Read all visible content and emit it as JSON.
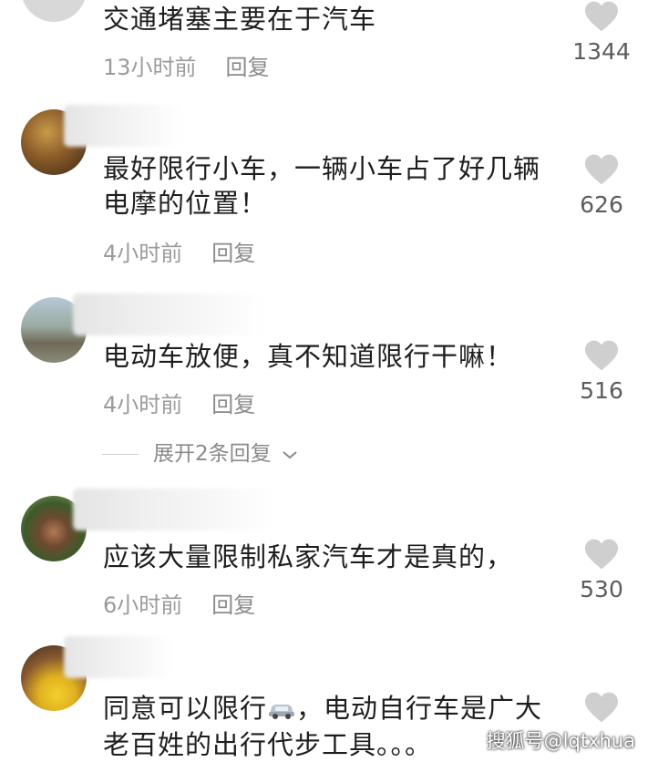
{
  "comments": [
    {
      "text_lines": [
        "交通堵塞主要在于汽车"
      ],
      "time": "13小时前",
      "reply_label": "回复",
      "likes": "1344"
    },
    {
      "text_lines": [
        "最好限行小车，一辆小车占了好几辆",
        "电摩的位置！"
      ],
      "time": "4小时前",
      "reply_label": "回复",
      "likes": "626"
    },
    {
      "text_lines": [
        "电动车放便，真不知道限行干嘛！"
      ],
      "time": "4小时前",
      "reply_label": "回复",
      "likes": "516",
      "expand_replies": "展开2条回复"
    },
    {
      "text_lines": [
        "应该大量限制私家汽车才是真的，"
      ],
      "time": "6小时前",
      "reply_label": "回复",
      "likes": "530"
    },
    {
      "text_lines_a": "同意可以限行",
      "text_lines_b": "，电动自行车是广大",
      "text_line_2": "老百姓的出行代步工具。。。",
      "emoji": "car-emoji"
    }
  ],
  "watermark": "搜狐号@lqtxhua",
  "colors": {
    "text": "#1e1e1e",
    "meta": "#9b9b9b",
    "heart": "#cfcfcf"
  },
  "icons": {
    "like": "heart-icon",
    "expand": "chevron-down-icon"
  }
}
